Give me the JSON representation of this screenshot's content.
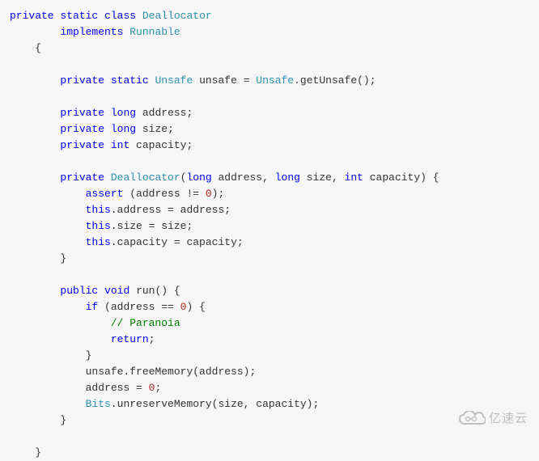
{
  "line01_a": "private",
  "line01_b": "static",
  "line01_c": "class",
  "line01_d": "Deallocator",
  "line02_a": "implements",
  "line02_b": "Runnable",
  "line03_a": "{",
  "line05_a": "private",
  "line05_b": "static",
  "line05_c": "Unsafe",
  "line05_d": " unsafe = ",
  "line05_e": "Unsafe",
  "line05_f": ".getUnsafe();",
  "line07_a": "private",
  "line07_b": "long",
  "line07_c": " address;",
  "line08_a": "private",
  "line08_b": "long",
  "line08_c": " size;",
  "line09_a": "private",
  "line09_b": "int",
  "line09_c": " capacity;",
  "line11_a": "private",
  "line11_b": "Deallocator",
  "line11_c": "(",
  "line11_d": "long",
  "line11_e": " address, ",
  "line11_f": "long",
  "line11_g": " size, ",
  "line11_h": "int",
  "line11_i": " capacity) {",
  "line12_a": "assert",
  "line12_b": " (address != ",
  "line12_c": "0",
  "line12_d": ");",
  "line13_a": "this",
  "line13_b": ".address = address;",
  "line14_a": "this",
  "line14_b": ".size = size;",
  "line15_a": "this",
  "line15_b": ".capacity = capacity;",
  "line16_a": "}",
  "line18_a": "public",
  "line18_b": "void",
  "line18_c": " run() {",
  "line19_a": "if",
  "line19_b": " (address == ",
  "line19_c": "0",
  "line19_d": ") {",
  "line20_a": "// Paranoia",
  "line21_a": "return",
  "line21_b": ";",
  "line22_a": "}",
  "line23_a": "unsafe.freeMemory(address);",
  "line24_a": "address = ",
  "line24_b": "0",
  "line24_c": ";",
  "line25_a": "Bits",
  "line25_b": ".unreserveMemory(size, capacity);",
  "line26_a": "}",
  "line28_a": "}",
  "watermark_text": "亿速云"
}
